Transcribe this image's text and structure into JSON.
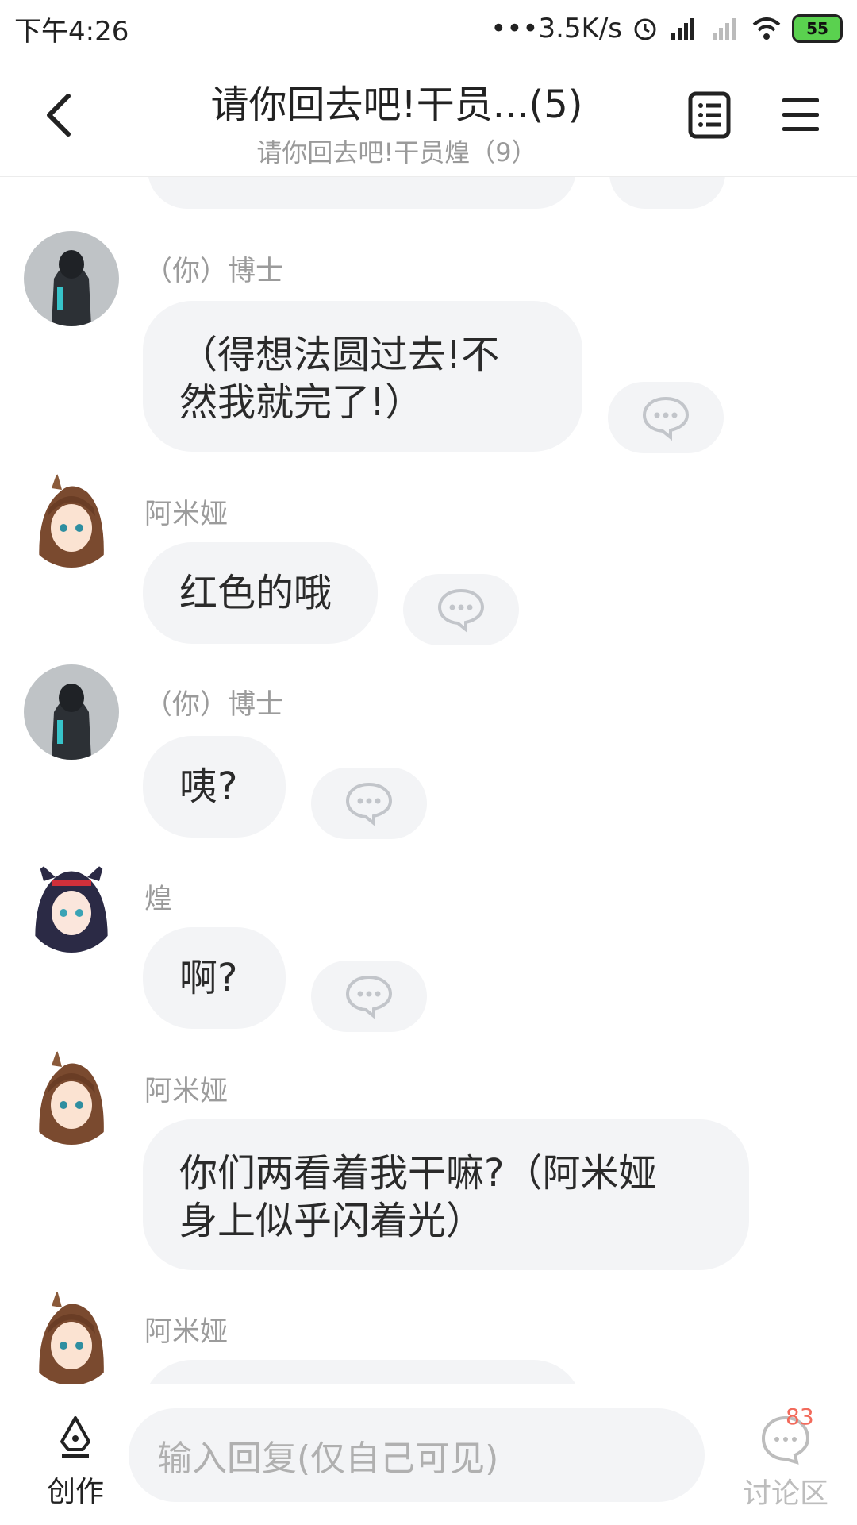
{
  "status": {
    "time": "下午4:26",
    "network": "•••3.5K/s",
    "battery": "55"
  },
  "header": {
    "title": "请你回去吧!干员...(5)",
    "subtitle": "请你回去吧!干员煌（9）"
  },
  "messages": [
    {
      "sender": "（你）博士",
      "text_lines": [
        "（得想法圆过去!不",
        "然我就完了!）"
      ],
      "avatar": "doctor-avatar"
    },
    {
      "sender": "阿米娅",
      "text_lines": [
        "红色的哦"
      ],
      "avatar": "amiya-avatar"
    },
    {
      "sender": "（你）博士",
      "text_lines": [
        "咦?"
      ],
      "avatar": "doctor-avatar"
    },
    {
      "sender": "煌",
      "text_lines": [
        "啊?"
      ],
      "avatar": "blaze-avatar"
    },
    {
      "sender": "阿米娅",
      "text_lines": [
        "你们两看着我干嘛?（阿米娅",
        "身上似乎闪着光）"
      ],
      "avatar": "amiya-avatar"
    },
    {
      "sender": "阿米娅",
      "text_lines": [
        ""
      ],
      "avatar": "amiya-avatar"
    }
  ],
  "bottom": {
    "create_label": "创作",
    "reply_placeholder": "输入回复(仅自己可见)",
    "discuss_label": "讨论区",
    "discuss_badge": "83"
  },
  "colors": {
    "bubble": "#f3f4f6",
    "badge": "#f26a5b",
    "battery": "#5ad14f"
  }
}
